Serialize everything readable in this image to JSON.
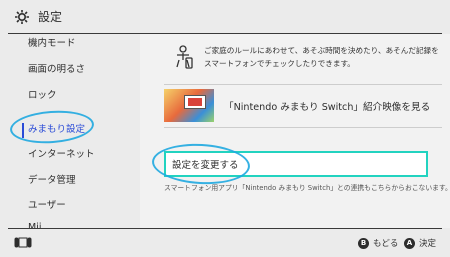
{
  "header": {
    "title": "設定",
    "icon": "gear-icon"
  },
  "sidebar": {
    "items": [
      {
        "label": "機内モード"
      },
      {
        "label": "画面の明るさ"
      },
      {
        "label": "ロック"
      },
      {
        "label": "みまもり設定"
      },
      {
        "label": "インターネット"
      },
      {
        "label": "データ管理"
      },
      {
        "label": "ユーザー"
      },
      {
        "label": "Mii"
      }
    ],
    "active_index": 3
  },
  "panel": {
    "intro_text": "ご家庭のルールにあわせて、あそぶ時間を決めたり、あそんだ記録をスマートフォンでチェックしたりできます。",
    "video_label": "「Nintendo みまもり Switch」紹介映像を見る",
    "change_button": "設定を変更する",
    "note": "スマートフォン用アプリ「Nintendo みまもり Switch」との連携もこちらからおこないます。"
  },
  "footer": {
    "back_key": "B",
    "back_label": "もどる",
    "ok_key": "A",
    "ok_label": "決定"
  },
  "colors": {
    "accent": "#2a4bd7",
    "focus": "#22d3c0",
    "annotation": "#1fa9e0"
  }
}
